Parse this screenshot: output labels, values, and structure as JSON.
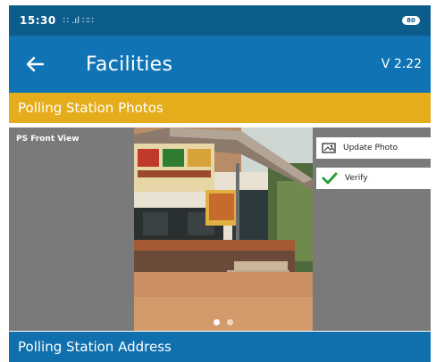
{
  "status_bar": {
    "time": "15:30",
    "icons_text": "∷ .ıl ∷∷",
    "battery": "80"
  },
  "app_bar": {
    "back_icon": "arrow-left-icon",
    "title": "Facilities",
    "version": "V 2.22"
  },
  "photos_section": {
    "title": "Polling Station Photos",
    "photo_label": "PS Front View",
    "carousel": {
      "pages": 2,
      "active_page": 1
    },
    "update_photo_label": "Update Photo",
    "update_photo_icon": "photo-icon",
    "verify_label": "Verify",
    "verify_icon": "checkmark-icon"
  },
  "address_section": {
    "title": "Polling Station Address"
  },
  "colors": {
    "status_bar": "#0d5d8c",
    "app_bar": "#1074b4",
    "section_header": "#e5ad1c",
    "photo_panel": "#7a7a7a",
    "address_bar": "#0f70ad",
    "verify_check": "#2e9e3a"
  }
}
